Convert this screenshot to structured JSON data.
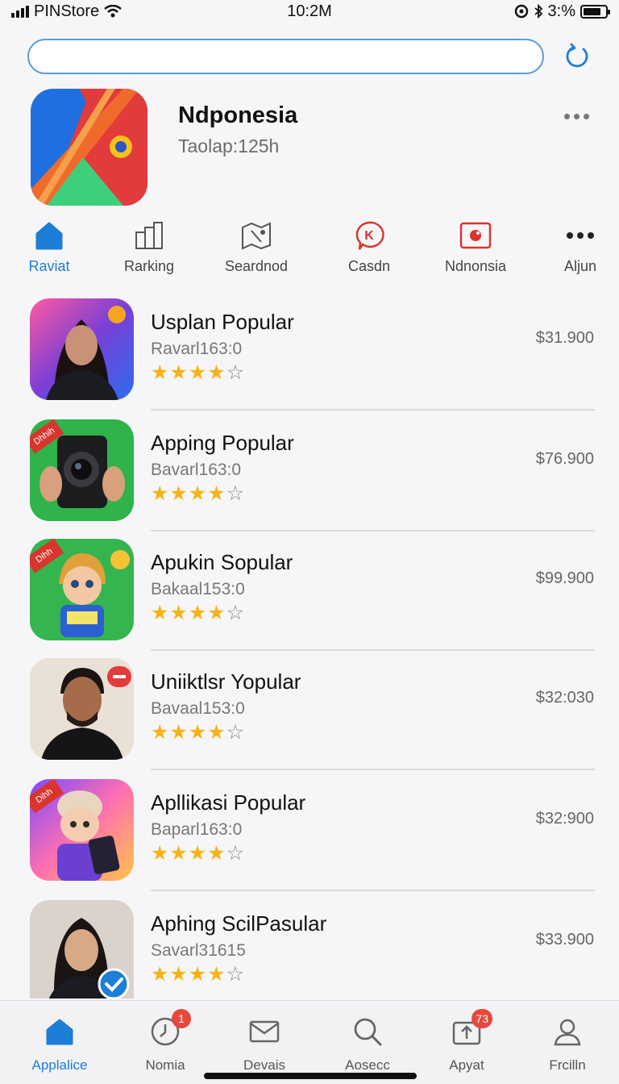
{
  "status_bar": {
    "carrier": "PINStore",
    "time": "10:2M",
    "battery": "3:%"
  },
  "search": {
    "placeholder": "",
    "value": ""
  },
  "app": {
    "name": "Ndponesia",
    "subtitle": "Taolap:125h"
  },
  "tabs": [
    {
      "label": "Raviat",
      "icon": "home-icon",
      "active": true
    },
    {
      "label": "Rarking",
      "icon": "ranking-icon"
    },
    {
      "label": "Seardnod",
      "icon": "map-icon"
    },
    {
      "label": "Casdn",
      "icon": "chat-badge-icon"
    },
    {
      "label": "Ndnonsia",
      "icon": "camera-icon"
    },
    {
      "label": "Aljun",
      "icon": "more-dots-icon"
    }
  ],
  "apps": [
    {
      "title": "Usplan Popular",
      "subtitle": "Ravarl163:0",
      "rating": 4,
      "price": "$31.900",
      "thumb": "portrait-woman"
    },
    {
      "title": "Apping Popular",
      "subtitle": "Bavarl163:0",
      "rating": 4,
      "price": "$76.900",
      "thumb": "camera",
      "flag": "Dhhih"
    },
    {
      "title": "Apukin Sopular",
      "subtitle": "Bakaal153:0",
      "rating": 4,
      "price": "$99.900",
      "thumb": "cartoon-boy",
      "flag": "Dihh"
    },
    {
      "title": "Uniiktlsr Yopular",
      "subtitle": "Bavaal153:0",
      "rating": 4,
      "price": "$32:030",
      "thumb": "portrait-man"
    },
    {
      "title": "Apllikasi Popular",
      "subtitle": "Baparl163:0",
      "rating": 4,
      "price": "$32:900",
      "thumb": "cartoon-kid",
      "flag": "Dihh"
    },
    {
      "title": "Aphing ScilPasular",
      "subtitle": "Savarl31615",
      "rating": 4,
      "price": "$33.900",
      "thumb": "portrait-woman-2"
    }
  ],
  "bottom_nav": [
    {
      "label": "Applalice",
      "icon": "home-icon",
      "active": true
    },
    {
      "label": "Nomia",
      "icon": "clock-icon",
      "badge": "1"
    },
    {
      "label": "Devais",
      "icon": "mail-icon"
    },
    {
      "label": "Aosecc",
      "icon": "search-icon"
    },
    {
      "label": "Apyat",
      "icon": "update-icon",
      "badge": "73"
    },
    {
      "label": "Frcilln",
      "icon": "profile-icon"
    }
  ],
  "colors": {
    "accent": "#1c7ed6",
    "star": "#f5b316",
    "badge": "#e8483b"
  }
}
